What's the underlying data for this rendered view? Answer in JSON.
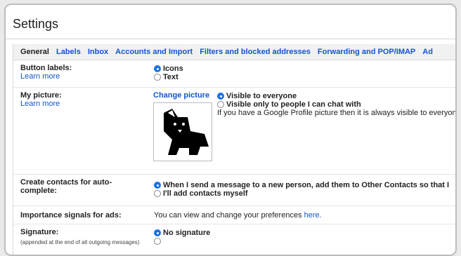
{
  "page": {
    "title": "Settings"
  },
  "tabs": [
    "General",
    "Labels",
    "Inbox",
    "Accounts and Import",
    "Filters and blocked addresses",
    "Forwarding and POP/IMAP",
    "Ad"
  ],
  "button_labels": {
    "label": "Button labels:",
    "learn_more": "Learn more",
    "options": [
      "Icons",
      "Text"
    ]
  },
  "my_picture": {
    "label": "My picture:",
    "learn_more": "Learn more",
    "change_link": "Change picture",
    "options": [
      "Visible to everyone",
      "Visible only to people I can chat with"
    ],
    "note": "If you have a Google Profile picture then it is always visible to everyone"
  },
  "contacts": {
    "label": "Create contacts for auto-complete:",
    "options": [
      "When I send a message to a new person, add them to Other Contacts so that I",
      "I'll add contacts myself"
    ]
  },
  "importance": {
    "label": "Importance signals for ads:",
    "text": "You can view and change your preferences",
    "link": "here."
  },
  "signature": {
    "label": "Signature:",
    "note": "(appended at the end of all outgoing messages)",
    "options": [
      "No signature"
    ]
  }
}
